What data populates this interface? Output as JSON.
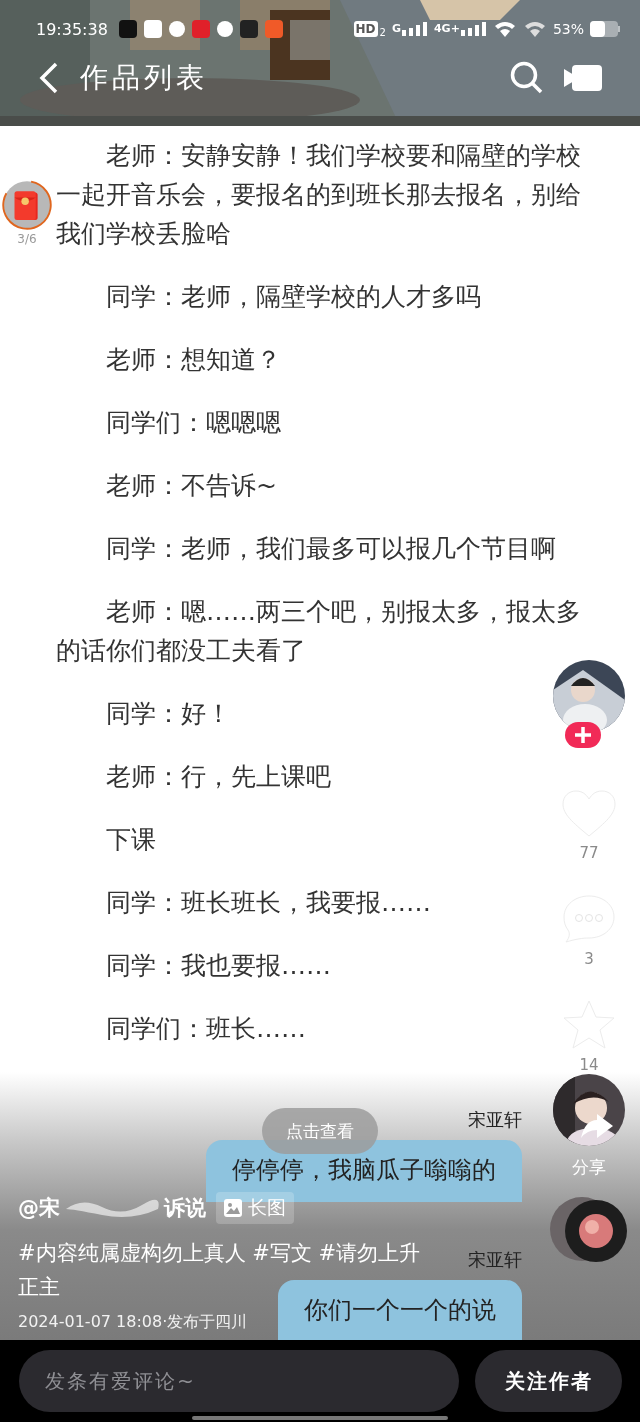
{
  "status_bar": {
    "time": "19:35:38",
    "hd": "HD",
    "hd_sub": "2",
    "network_1": "G",
    "network_2": "4G+",
    "battery": "53%"
  },
  "nav": {
    "title": "作品列表"
  },
  "red_packet": {
    "progress": "3/6"
  },
  "paragraphs": [
    "老师：安静安静！我们学校要和隔壁的学校一起开音乐会，要报名的到班长那去报名，别给我们学校丢脸哈",
    "同学：老师，隔壁学校的人才多吗",
    "老师：想知道？",
    "同学们：嗯嗯嗯",
    "老师：不告诉~",
    "同学：老师，我们最多可以报几个节目啊",
    "老师：嗯……两三个吧，别报太多，报太多的话你们都没工夫看了",
    "同学：好！",
    "老师：行，先上课吧",
    "下课",
    "同学：班长班长，我要报……",
    "同学：我也要报……",
    "同学们：班长……"
  ],
  "sidebar": {
    "like_count": "77",
    "comment_count": "3",
    "favorite_count": "14",
    "share_label": "分享"
  },
  "video": {
    "button": "点击查看",
    "messages": [
      {
        "sender": "宋亚轩",
        "text": "停停停，我脑瓜子嗡嗡的"
      },
      {
        "sender": "宋亚轩",
        "text": "你们一个一个的说"
      }
    ]
  },
  "post": {
    "author_start": "@宋",
    "author_end": "诉说",
    "badge": "长图",
    "hashtags": "#内容纯属虚构勿上真人 #写文 #请勿上升正主",
    "meta": "2024-01-07 18:08·发布于四川"
  },
  "bottom_bar": {
    "placeholder": "发条有爱评论~",
    "follow_button": "关注作者"
  }
}
